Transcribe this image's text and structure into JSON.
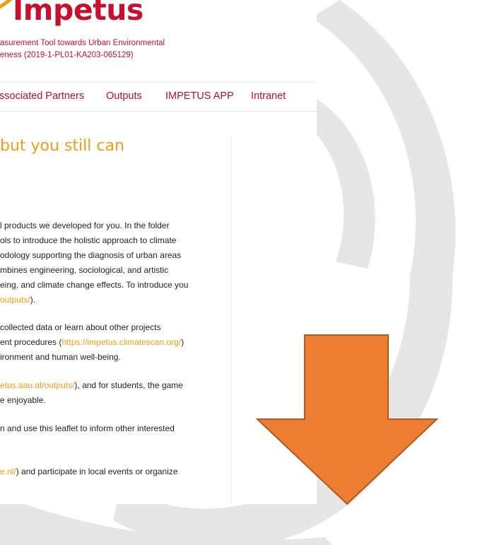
{
  "header": {
    "logo_text": "Impetus",
    "subtitle_line1": "asurement Tool towards Urban Environmental",
    "subtitle_line2": "eness (2019-1-PL01-KA203-065129)"
  },
  "nav": {
    "items": [
      {
        "label": "ssociated Partners"
      },
      {
        "label": "Outputs"
      },
      {
        "label": "IMPETUS APP"
      },
      {
        "label": "Intranet"
      }
    ]
  },
  "main": {
    "heading": "but you still can",
    "paragraphs": {
      "p1": [
        "l products we developed for you. In the folder",
        "ols to introduce the holistic approach to climate",
        "odology supporting the diagnosis of urban areas",
        "mbines engineering, sociological, and artistic",
        "eing, and climate change effects. To introduce you"
      ],
      "p1_end_link": "outputs/",
      "p1_end_text": ").",
      "p2_line1": "collected data or learn about other projects",
      "p2_line2_text": "ent procedures (",
      "p2_line2_link": "https://impetus.climatescan.org/",
      "p2_line2_end": ")",
      "p2_line3": "ironment and human well-being.",
      "p3_line1_link": "etus.aau.at/outputs/",
      "p3_line1_text": "), and for students, the game",
      "p3_line2": "e enjoyable.",
      "p4_line1": "n and use this leaflet to inform other interested",
      "p5_line1_link": "e.nl/",
      "p5_line1_text": ") and participate in local events or organize"
    }
  },
  "colors": {
    "brand_red": "#c8102e",
    "accent_orange": "#f39c12",
    "arrow_fill": "#ed7d31",
    "arrow_stroke": "#ae5a21",
    "ring_grey": "#e6e6e6"
  },
  "icons": {
    "logo_mark": "swoosh-logo-icon",
    "overlay_arrow": "down-arrow-icon"
  }
}
